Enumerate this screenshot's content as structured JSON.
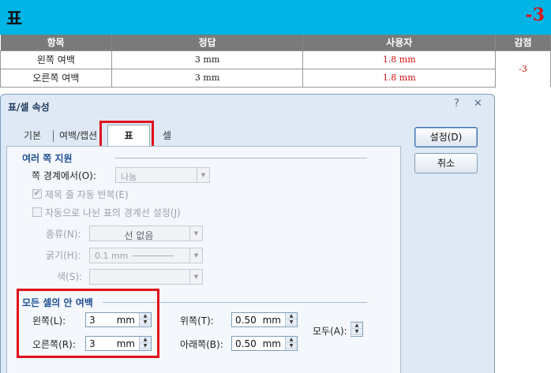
{
  "banner": {
    "title": "표",
    "score": "-3"
  },
  "grade_table": {
    "headers": [
      "항목",
      "정답",
      "사용자",
      "감점"
    ],
    "rows": [
      {
        "item": "왼쪽 여백",
        "answer": "3 mm",
        "user": "1.8 mm"
      },
      {
        "item": "오른쪽 여백",
        "answer": "3 mm",
        "user": "1.8 mm"
      }
    ],
    "deduction": "-3"
  },
  "dialog": {
    "title": "표/셀 속성",
    "help_glyph": "?",
    "close_glyph": "✕",
    "tabs": [
      "기본",
      "여백/캡션",
      "표",
      "셀"
    ],
    "active_tab": "표",
    "group_multi": {
      "title": "여러 쪽 지원",
      "page_boundary_label": "쪽 경계에서(O):",
      "page_boundary_value": "나눔",
      "repeat_header_label": "제목 줄 자동 반복(E)",
      "repeat_header_checked": true,
      "auto_border_label": "자동으로 나뉜 표의 경계선 설정(J)",
      "auto_border_checked": false,
      "type_label": "종류(N):",
      "type_value": "선 없음",
      "thickness_label": "굵기(H):",
      "thickness_value": "0.1 mm",
      "color_label": "색(S):"
    },
    "group_inner": {
      "title": "모든 셀의 안 여백",
      "left_label": "왼쪽(L):",
      "left_value": "3",
      "right_label": "오른쪽(R):",
      "right_value": "3",
      "top_label": "위쪽(T):",
      "top_value": "0.50",
      "bottom_label": "아래쪽(B):",
      "bottom_value": "0.50",
      "all_label": "모두(A):",
      "unit": "mm"
    },
    "buttons": {
      "ok": "설정(D)",
      "cancel": "취소"
    }
  }
}
